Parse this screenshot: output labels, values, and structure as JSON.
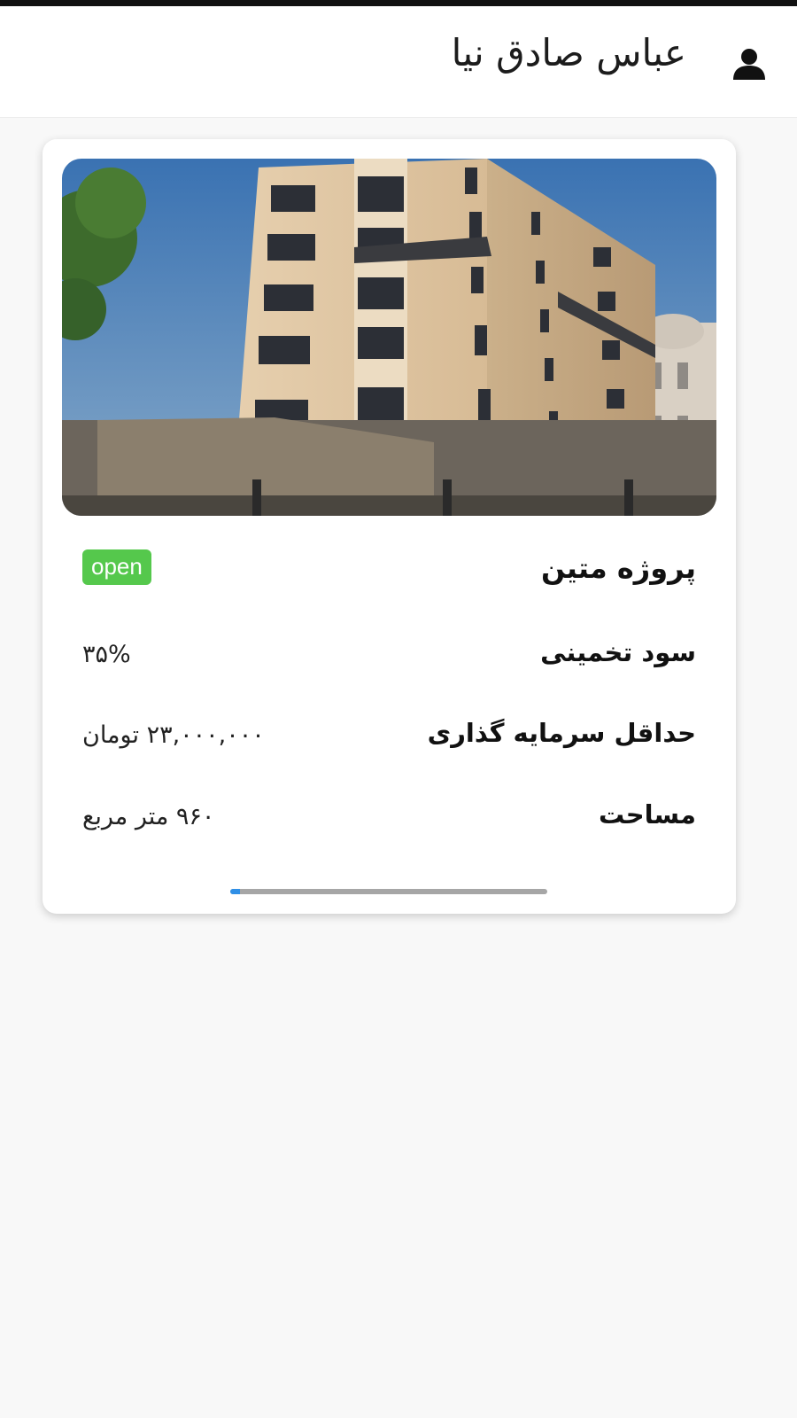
{
  "header": {
    "user_name": "عباس صادق نیا",
    "user_icon": "person-icon"
  },
  "project_card": {
    "image": {
      "description_icon": "building-photo",
      "alt": ""
    },
    "title": "پروژه متین",
    "status": "open",
    "status_color": "#55c84c",
    "fields": [
      {
        "label": "سود تخمینی",
        "value": "۳۵%"
      },
      {
        "label": "حداقل سرمایه گذاری",
        "value": "۲۳,۰۰۰,۰۰۰ تومان"
      },
      {
        "label": "مساحت",
        "value": "۹۶۰ متر مربع"
      }
    ],
    "progress": {
      "fraction": 0.03,
      "fill_color": "#2f8fe6",
      "track_color": "#a6a6a6"
    }
  },
  "colors": {
    "background": "#f8f8f8",
    "card": "#ffffff",
    "text": "#111111"
  }
}
